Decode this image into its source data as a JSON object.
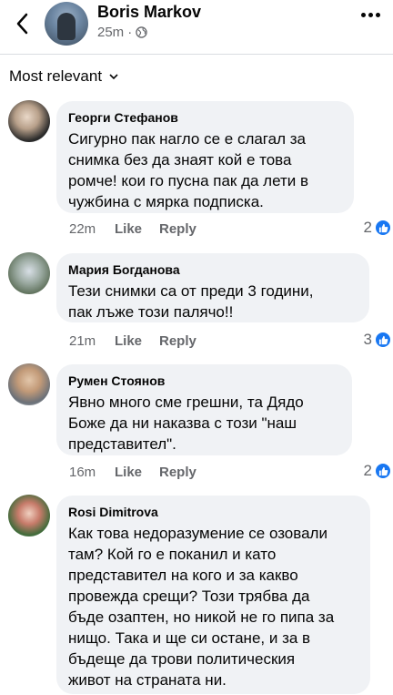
{
  "header": {
    "author": "Boris Markov",
    "time": "25m",
    "separator": "·"
  },
  "sort": {
    "label": "Most relevant"
  },
  "comments": [
    {
      "name": "Георги Стефанов",
      "lines": [
        "Сигурно пак нагло се е слагал за",
        "снимка без да знаят кой е това",
        "ромче! кои го пусна пак да лети в",
        "чужбина с мярка подписка."
      ],
      "time": "22m",
      "like": "Like",
      "reply": "Reply",
      "reactions": "2"
    },
    {
      "name": "Мария Богданова",
      "lines": [
        "Тези снимки са от преди 3 години,",
        "пак лъже този палячо!!"
      ],
      "time": "21m",
      "like": "Like",
      "reply": "Reply",
      "reactions": "3"
    },
    {
      "name": "Румен Стоянов",
      "lines": [
        "Явно много сме грешни, та Дядо",
        "Боже да ни наказва с този \"наш",
        "представител\"."
      ],
      "time": "16m",
      "like": "Like",
      "reply": "Reply",
      "reactions": "2"
    },
    {
      "name": "Rosi Dimitrova",
      "lines": [
        "Как това недоразумение се озовали",
        "там? Кой го е поканил и като",
        "представител на кого и за какво",
        "провежда срещи? Този трябва да",
        "бъде озаптен, но никой не го пипа за",
        "нищо. Така и ще си остане, и за в",
        "бъдеще да трови политическия",
        "живот на страната ни."
      ]
    }
  ],
  "colors": {
    "accent": "#1877f2",
    "bubble": "#f0f2f5",
    "muted": "#65676b"
  }
}
